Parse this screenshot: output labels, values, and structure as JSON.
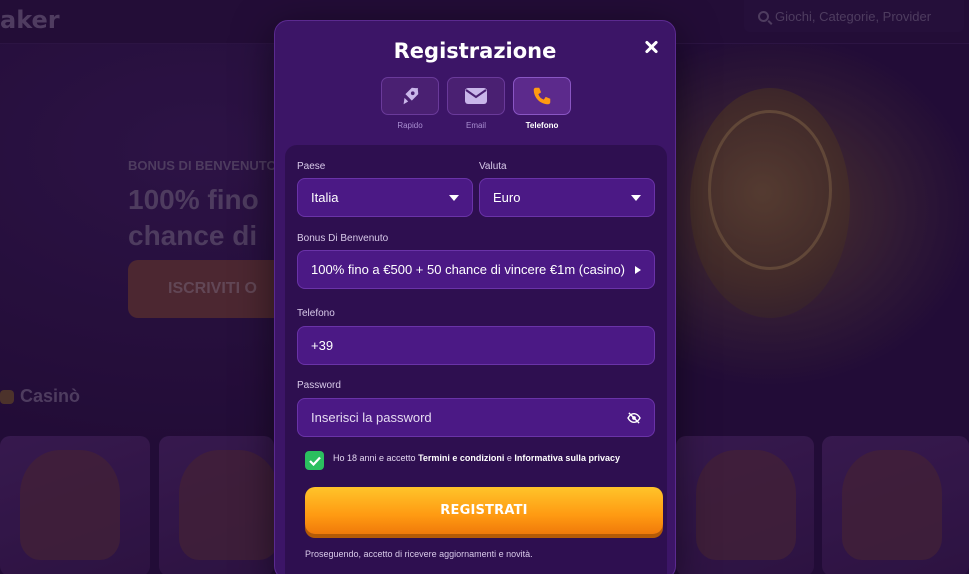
{
  "background": {
    "logo": "aker",
    "search_placeholder": "Giochi, Categorie, Provider",
    "bonus_label": "BONUS DI BENVENUTO",
    "bonus_title_line1": "100% fino",
    "bonus_title_line2": "chance di",
    "cta_label": "ISCRIVITI O",
    "section_title": "Casinò"
  },
  "modal": {
    "title": "Registrazione",
    "methods": [
      {
        "label": "Rapido",
        "icon": "rocket-icon",
        "active": false
      },
      {
        "label": "Email",
        "icon": "mail-icon",
        "active": false
      },
      {
        "label": "Telefono",
        "icon": "phone-icon",
        "active": true
      }
    ],
    "country": {
      "label": "Paese",
      "value": "Italia"
    },
    "currency": {
      "label": "Valuta",
      "value": "Euro"
    },
    "bonus": {
      "label": "Bonus Di Benvenuto",
      "value": "100% fino a €500 + 50 chance di vincere €1m (casino)"
    },
    "phone": {
      "label": "Telefono",
      "value": "+39"
    },
    "password": {
      "label": "Password",
      "placeholder": "Inserisci la password"
    },
    "terms": {
      "prefix": "Ho 18 anni e accetto ",
      "terms_link": "Termini e condizioni",
      "middle": " e ",
      "privacy_link": "Informativa sulla privacy",
      "checked": true
    },
    "submit_label": "REGISTRATI",
    "footnote": "Proseguendo, accetto di ricevere aggiornamenti e novità."
  },
  "colors": {
    "accent_orange": "#ff9a12",
    "check_green": "#2bbf5f",
    "modal_bg": "#3c1567",
    "field_bg": "#4b1985"
  }
}
